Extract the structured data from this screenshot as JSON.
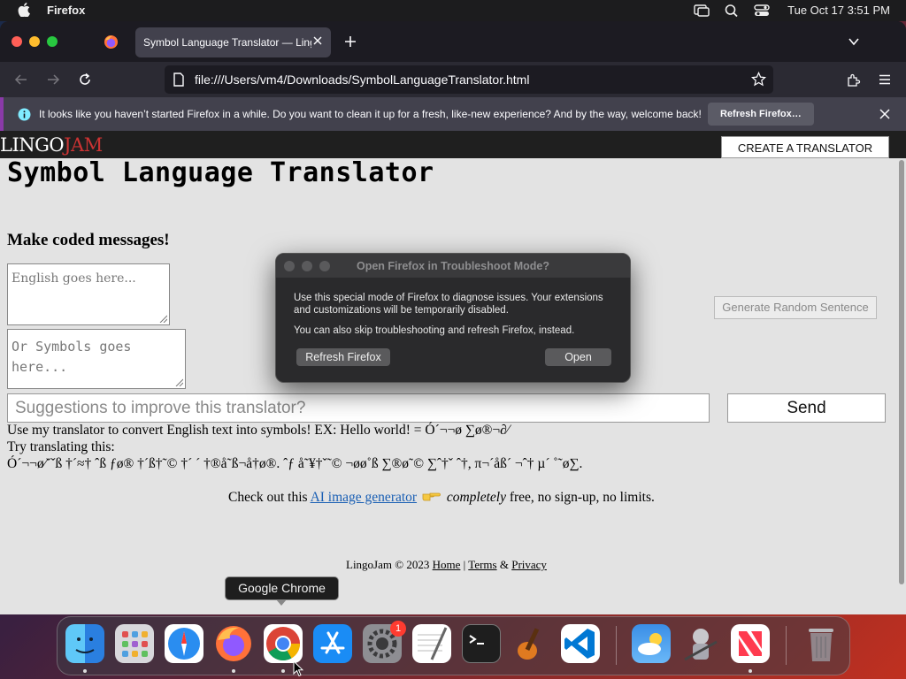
{
  "menubar": {
    "app_name": "Firefox",
    "clock": "Tue Oct 17  3:51 PM",
    "status_icons": [
      "display-icon",
      "search-icon",
      "control-center-icon"
    ]
  },
  "browser": {
    "tab_title": "Symbol Language Translator — LingoJam",
    "url": "file:///Users/vm4/Downloads/SymbolLanguageTranslator.html",
    "notification": {
      "text": "It looks like you haven’t started Firefox in a while. Do you want to clean it up for a fresh, like-new experience? And by the way, welcome back!",
      "button_label": "Refresh Firefox…"
    }
  },
  "page": {
    "logo_part1": "LINGO",
    "logo_part2": "JAM",
    "create_button": "CREATE A TRANSLATOR",
    "title": "Symbol Language Translator",
    "subtitle": "Make coded messages!",
    "english_placeholder": "English goes here...",
    "symbols_placeholder": "Or Symbols goes here...",
    "random_button": "Generate Random Sentence",
    "suggest_placeholder": "Suggestions to improve this translator?",
    "send_button": "Send",
    "usage_text": "Use my translator to convert English text into symbols! EX: Hello world! = Ó´¬¬ø ∑ø®¬∂⁄",
    "try_label": "Try translating this:",
    "try_symbols": "Ó´¬¬ø⁄˘ˇß †´≈† ˆß ƒø® †´ß†˜© †´ ´ †®å˜ß¬å†ø®. ˆƒ å˜¥†ˇ˜© ¬øø˚ß ∑®ø˜© ∑ˆ†ˇ ˆ†, π¬´åß´ ¬ˆ† µ´ ˚˜ø∑.",
    "promo_before": "Check out this ",
    "promo_link": "AI image generator",
    "promo_em": "completely",
    "promo_after": " free, no sign-up, no limits.",
    "footer_copy": "LingoJam © 2023 ",
    "footer_home": "Home",
    "footer_terms": "Terms",
    "footer_amp": " & ",
    "footer_privacy": "Privacy",
    "footer_sep": " | "
  },
  "dialog": {
    "title": "Open Firefox in Troubleshoot Mode?",
    "message1": "Use this special mode of Firefox to diagnose issues. Your extensions and customizations will be temporarily disabled.",
    "message2": "You can also skip troubleshooting and refresh Firefox, instead.",
    "refresh_button": "Refresh Firefox",
    "open_button": "Open"
  },
  "dock": {
    "tooltip": "Google Chrome",
    "badge_count": "1",
    "apps": [
      "finder-icon",
      "launchpad-icon",
      "safari-icon",
      "firefox-icon",
      "chrome-icon",
      "app-store-icon",
      "system-settings-icon",
      "textedit-icon",
      "terminal-icon",
      "garageband-icon",
      "vscode-icon",
      "weather-icon",
      "automator-icon",
      "news-icon",
      "trash-icon"
    ]
  },
  "colors": {
    "logo_accent": "#cc3333",
    "link": "#1a5fb4",
    "notification_bar": "#42414d"
  }
}
